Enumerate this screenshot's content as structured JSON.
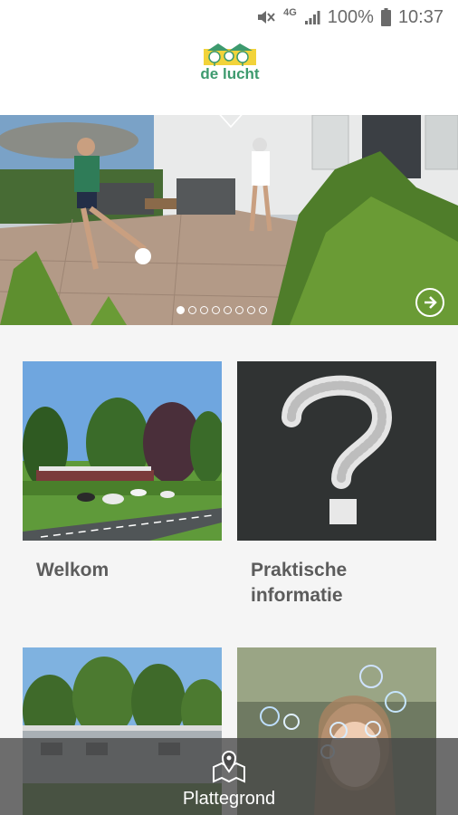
{
  "status_bar": {
    "network": "4G",
    "battery": "100%",
    "time": "10:37",
    "icons": [
      "mute-icon",
      "signal-icon",
      "battery-icon"
    ]
  },
  "header": {
    "logo_text": "de lucht"
  },
  "carousel": {
    "slide_count": 8,
    "active_index": 0,
    "next_icon": "arrow-right-circle-icon"
  },
  "cards": [
    {
      "label": "Welkom",
      "image": "countryside-cows-road"
    },
    {
      "label": "Praktische informatie",
      "image": "chalkboard-question-mark"
    },
    {
      "label": "",
      "image": "holiday-chalets-park"
    },
    {
      "label": "",
      "image": "girl-soap-bubbles"
    }
  ],
  "bottom_nav": {
    "label": "Plattegrond",
    "icon": "map-pin-icon"
  },
  "colors": {
    "brand_green": "#3d9a6e",
    "logo_yellow": "#f2d33a",
    "text_gray": "#5c5c5c"
  }
}
